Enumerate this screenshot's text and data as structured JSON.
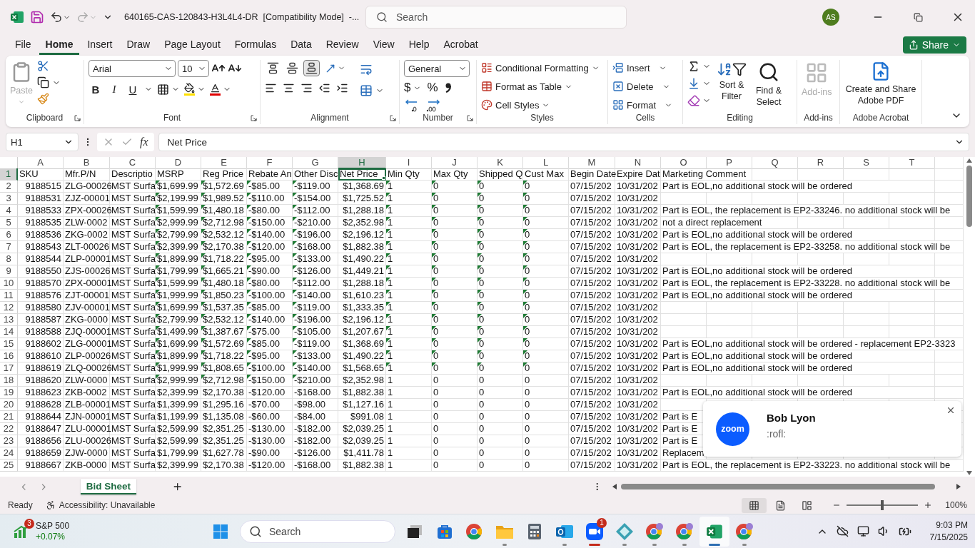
{
  "title_bar": {
    "document": "640165-CAS-120843-H3L4L4-DR  [Compatibility Mode]  -...",
    "search_placeholder": "Search",
    "avatar": "AS"
  },
  "menu_tabs": [
    {
      "label": "File",
      "selected": false
    },
    {
      "label": "Home",
      "selected": true
    },
    {
      "label": "Insert",
      "selected": false
    },
    {
      "label": "Draw",
      "selected": false
    },
    {
      "label": "Page Layout",
      "selected": false
    },
    {
      "label": "Formulas",
      "selected": false
    },
    {
      "label": "Data",
      "selected": false
    },
    {
      "label": "Review",
      "selected": false
    },
    {
      "label": "View",
      "selected": false
    },
    {
      "label": "Help",
      "selected": false
    },
    {
      "label": "Acrobat",
      "selected": false
    }
  ],
  "share_button": "Share",
  "ribbon": {
    "clipboard": {
      "paste": "Paste",
      "label": "Clipboard"
    },
    "font": {
      "font_name": "Arial",
      "font_size": "10",
      "bold": "B",
      "italic": "I",
      "underline": "U",
      "label": "Font"
    },
    "alignment": {
      "vertical": [
        {
          "kind": "top",
          "selected": false
        },
        {
          "kind": "middle",
          "selected": false
        },
        {
          "kind": "bottom",
          "selected": true
        }
      ],
      "label": "Alignment"
    },
    "number": {
      "format": "General",
      "currency": "$",
      "percent": "%",
      "label": "Number"
    },
    "styles": {
      "commands": [
        "Conditional Formatting",
        "Format as Table",
        "Cell Styles"
      ],
      "label": "Styles"
    },
    "cells": {
      "commands": [
        "Insert",
        "Delete",
        "Format"
      ],
      "label": "Cells"
    },
    "editing": {
      "sort": "Sort & Filter",
      "find": "Find & Select",
      "label": "Editing"
    },
    "addins": {
      "button": "Add-ins",
      "disabled": true,
      "label": "Add-ins"
    },
    "acrobat": {
      "button": "Create and Share Adobe PDF",
      "label": "Adobe Acrobat"
    }
  },
  "formula_bar": {
    "name_box": "H1",
    "function_symbol": "fx",
    "formula": "Net Price"
  },
  "sheet": {
    "columns": [
      {
        "letter": "A",
        "selected": false
      },
      {
        "letter": "B",
        "selected": false
      },
      {
        "letter": "C",
        "selected": false
      },
      {
        "letter": "D",
        "selected": false
      },
      {
        "letter": "E",
        "selected": false
      },
      {
        "letter": "F",
        "selected": false
      },
      {
        "letter": "G",
        "selected": false
      },
      {
        "letter": "H",
        "selected": true
      },
      {
        "letter": "I",
        "selected": false
      },
      {
        "letter": "J",
        "selected": false
      },
      {
        "letter": "K",
        "selected": false
      },
      {
        "letter": "L",
        "selected": false
      },
      {
        "letter": "M",
        "selected": false
      },
      {
        "letter": "N",
        "selected": false
      },
      {
        "letter": "O",
        "selected": false
      },
      {
        "letter": "P",
        "selected": false
      },
      {
        "letter": "Q",
        "selected": false
      },
      {
        "letter": "R",
        "selected": false
      },
      {
        "letter": "S",
        "selected": false
      },
      {
        "letter": "T",
        "selected": false
      }
    ],
    "rows": [
      {
        "number": "1",
        "selected": true,
        "flagged_prices": false,
        "flagged_qty": false,
        "cells": [
          "SKU",
          "Mfr.P/N",
          "Descriptio",
          "MSRP",
          "Reg Price",
          "Rebate An",
          "Other Disc",
          "Net Price",
          "Min Qty",
          "Max Qty",
          "Shipped Q",
          "Cust Max",
          "Begin Date",
          "Expire Dat"
        ],
        "comment": "Marketing Comment"
      },
      {
        "number": "2",
        "selected": false,
        "flagged_prices": true,
        "flagged_qty": true,
        "cells": [
          "9188515",
          "ZLG-00026",
          "MST Surfa",
          "$1,699.99",
          "$1,572.69",
          "-$85.00",
          "-$119.00",
          "$1,368.69",
          "1",
          "0",
          "0",
          "0",
          "07/15/202",
          "10/31/202"
        ],
        "comment": "Part is EOL,no additional stock will be ordered"
      },
      {
        "number": "3",
        "selected": false,
        "flagged_prices": true,
        "flagged_qty": true,
        "cells": [
          "9188531",
          "ZJZ-00001",
          "MST Surfa",
          "$2,199.99",
          "$1,989.52",
          "-$110.00",
          "-$154.00",
          "$1,725.52",
          "1",
          "0",
          "0",
          "0",
          "07/15/202",
          "10/31/202"
        ]
      },
      {
        "number": "4",
        "selected": false,
        "flagged_prices": true,
        "flagged_qty": true,
        "cells": [
          "9188533",
          "ZPX-00026",
          "MST Surfa",
          "$1,599.99",
          "$1,480.18",
          "-$80.00",
          "-$112.00",
          "$1,288.18",
          "1",
          "0",
          "0",
          "0",
          "07/15/202",
          "10/31/202"
        ],
        "comment": "Part is EOL, the replacement is EP2-33246. no additional stock will be"
      },
      {
        "number": "5",
        "selected": false,
        "flagged_prices": true,
        "flagged_qty": true,
        "cells": [
          "9188535",
          "ZLW-0002",
          "MST Surfa",
          "$2,999.99",
          "$2,712.98",
          "-$150.00",
          "-$210.00",
          "$2,352.98",
          "1",
          "0",
          "0",
          "0",
          "07/15/202",
          "10/31/202"
        ],
        "comment": "not a direct replacement"
      },
      {
        "number": "6",
        "selected": false,
        "flagged_prices": true,
        "flagged_qty": true,
        "cells": [
          "9188536",
          "ZKG-0002",
          "MST Surfa",
          "$2,799.99",
          "$2,532.12",
          "-$140.00",
          "-$196.00",
          "$2,196.12",
          "1",
          "0",
          "0",
          "0",
          "07/15/202",
          "10/31/202"
        ],
        "comment": "Part is EOL,no additional stock will be ordered"
      },
      {
        "number": "7",
        "selected": false,
        "flagged_prices": true,
        "flagged_qty": true,
        "cells": [
          "9188543",
          "ZLT-00026",
          "MST Surfa",
          "$2,399.99",
          "$2,170.38",
          "-$120.00",
          "-$168.00",
          "$1,882.38",
          "1",
          "0",
          "0",
          "0",
          "07/15/202",
          "10/31/202"
        ],
        "comment": "Part is EOL, the replacement is EP2-33258. no additional stock will be"
      },
      {
        "number": "8",
        "selected": false,
        "flagged_prices": true,
        "flagged_qty": true,
        "cells": [
          "9188544",
          "ZLP-00001",
          "MST Surfa",
          "$1,899.99",
          "$1,718.22",
          "-$95.00",
          "-$133.00",
          "$1,490.22",
          "1",
          "0",
          "0",
          "0",
          "07/15/202",
          "10/31/202"
        ]
      },
      {
        "number": "9",
        "selected": false,
        "flagged_prices": true,
        "flagged_qty": true,
        "cells": [
          "9188550",
          "ZJS-00026",
          "MST Surfa",
          "$1,799.99",
          "$1,665.21",
          "-$90.00",
          "-$126.00",
          "$1,449.21",
          "1",
          "0",
          "0",
          "0",
          "07/15/202",
          "10/31/202"
        ],
        "comment": "Part is EOL,no additional stock will be ordered"
      },
      {
        "number": "10",
        "selected": false,
        "flagged_prices": true,
        "flagged_qty": true,
        "cells": [
          "9188570",
          "ZPX-00001",
          "MST Surfa",
          "$1,599.99",
          "$1,480.18",
          "-$80.00",
          "-$112.00",
          "$1,288.18",
          "1",
          "0",
          "0",
          "0",
          "07/15/202",
          "10/31/202"
        ],
        "comment": "Part is EOL, the replacement is EP2-33228. no additional stock will be"
      },
      {
        "number": "11",
        "selected": false,
        "flagged_prices": true,
        "flagged_qty": true,
        "cells": [
          "9188576",
          "ZJT-00001",
          "MST Surfa",
          "$1,999.99",
          "$1,850.23",
          "-$100.00",
          "-$140.00",
          "$1,610.23",
          "1",
          "0",
          "0",
          "0",
          "07/15/202",
          "10/31/202"
        ],
        "comment": "Part is EOL,no additional stock will be ordered"
      },
      {
        "number": "12",
        "selected": false,
        "flagged_prices": true,
        "flagged_qty": true,
        "cells": [
          "9188580",
          "ZJV-00001",
          "MST Surfa",
          "$1,699.99",
          "$1,537.35",
          "-$85.00",
          "-$119.00",
          "$1,333.35",
          "1",
          "0",
          "0",
          "0",
          "07/15/202",
          "10/31/202"
        ]
      },
      {
        "number": "13",
        "selected": false,
        "flagged_prices": true,
        "flagged_qty": true,
        "cells": [
          "9188587",
          "ZKG-0000",
          "MST Surfa",
          "$2,799.99",
          "$2,532.12",
          "-$140.00",
          "-$196.00",
          "$2,196.12",
          "1",
          "0",
          "0",
          "0",
          "07/15/202",
          "10/31/202"
        ]
      },
      {
        "number": "14",
        "selected": false,
        "flagged_prices": true,
        "flagged_qty": true,
        "cells": [
          "9188588",
          "ZJQ-00001",
          "MST Surfa",
          "$1,499.99",
          "$1,387.67",
          "-$75.00",
          "-$105.00",
          "$1,207.67",
          "1",
          "0",
          "0",
          "0",
          "07/15/202",
          "10/31/202"
        ]
      },
      {
        "number": "15",
        "selected": false,
        "flagged_prices": true,
        "flagged_qty": true,
        "cells": [
          "9188602",
          "ZLG-00001",
          "MST Surfa",
          "$1,699.99",
          "$1,572.69",
          "-$85.00",
          "-$119.00",
          "$1,368.69",
          "1",
          "0",
          "0",
          "0",
          "07/15/202",
          "10/31/202"
        ],
        "comment": "Part is EOL,no additional stock will be ordered - replacement EP2-3323"
      },
      {
        "number": "16",
        "selected": false,
        "flagged_prices": true,
        "flagged_qty": true,
        "cells": [
          "9188610",
          "ZLP-00026",
          "MST Surfa",
          "$1,899.99",
          "$1,718.22",
          "-$95.00",
          "-$133.00",
          "$1,490.22",
          "1",
          "0",
          "0",
          "0",
          "07/15/202",
          "10/31/202"
        ],
        "comment": "Part is EOL,no additional stock will be ordered"
      },
      {
        "number": "17",
        "selected": false,
        "flagged_prices": true,
        "flagged_qty": true,
        "cells": [
          "9188619",
          "ZLQ-00026",
          "MST Surfa",
          "$1,999.99",
          "$1,808.65",
          "-$100.00",
          "-$140.00",
          "$1,568.65",
          "1",
          "0",
          "0",
          "0",
          "07/15/202",
          "10/31/202"
        ],
        "comment": "Part is EOL,no additional stock will be ordered"
      },
      {
        "number": "18",
        "selected": false,
        "flagged_prices": true,
        "flagged_qty": false,
        "cells": [
          "9188620",
          "ZLW-0000",
          "MST Surfa",
          "$2,999.99",
          "$2,712.98",
          "-$150.00",
          "-$210.00",
          "$2,352.98",
          "1",
          "0",
          "0",
          "0",
          "07/15/202",
          "10/31/202"
        ]
      },
      {
        "number": "19",
        "selected": false,
        "flagged_prices": false,
        "flagged_qty": false,
        "cells": [
          "9188623",
          "ZKB-0002",
          "MST Surfa",
          "$2,399.99",
          "$2,170.38",
          "-$120.00",
          "-$168.00",
          "$1,882.38",
          "1",
          "0",
          "0",
          "0",
          "07/15/202",
          "10/31/202"
        ],
        "comment": "Part is EOL,no additional stock will be ordered"
      },
      {
        "number": "20",
        "selected": false,
        "flagged_prices": false,
        "flagged_qty": false,
        "cells": [
          "9188628",
          "ZLB-00001",
          "MST Surfa",
          "$1,399.99",
          "$1,295.16",
          "-$70.00",
          "-$98.00",
          "$1,127.16",
          "1",
          "0",
          "0",
          "0",
          "07/15/202",
          "10/31/202"
        ]
      },
      {
        "number": "21",
        "selected": false,
        "flagged_prices": false,
        "flagged_qty": false,
        "cells": [
          "9188644",
          "ZJN-00001",
          "MST Surfa",
          "$1,199.99",
          "$1,135.08",
          "-$60.00",
          "-$84.00",
          "$991.08",
          "1",
          "0",
          "0",
          "0",
          "07/15/202",
          "10/31/202"
        ],
        "comment": "Part is E"
      },
      {
        "number": "22",
        "selected": false,
        "flagged_prices": false,
        "flagged_qty": false,
        "cells": [
          "9188647",
          "ZLU-00001",
          "MST Surfa",
          "$2,599.99",
          "$2,351.25",
          "-$130.00",
          "-$182.00",
          "$2,039.25",
          "1",
          "0",
          "0",
          "0",
          "07/15/202",
          "10/31/202"
        ],
        "comment": "Part is E"
      },
      {
        "number": "23",
        "selected": false,
        "flagged_prices": false,
        "flagged_qty": false,
        "cells": [
          "9188656",
          "ZLU-00026",
          "MST Surfa",
          "$2,599.99",
          "$2,351.25",
          "-$130.00",
          "-$182.00",
          "$2,039.25",
          "1",
          "0",
          "0",
          "0",
          "07/15/202",
          "10/31/202"
        ],
        "comment": "Part is E"
      },
      {
        "number": "24",
        "selected": false,
        "flagged_prices": false,
        "flagged_qty": false,
        "cells": [
          "9188659",
          "ZJW-0000",
          "MST Surfa",
          "$1,799.99",
          "$1,627.78",
          "-$90.00",
          "-$126.00",
          "$1,411.78",
          "1",
          "0",
          "0",
          "0",
          "07/15/202",
          "10/31/202"
        ],
        "comment": "Replacem"
      },
      {
        "number": "25",
        "selected": false,
        "flagged_prices": false,
        "flagged_qty": false,
        "cells": [
          "9188667",
          "ZKB-0000",
          "MST Surfa",
          "$2,399.99",
          "$2,170.38",
          "-$120.00",
          "-$168.00",
          "$1,882.38",
          "1",
          "0",
          "0",
          "0",
          "07/15/202",
          "10/31/202"
        ],
        "comment": "Part is EOL, the replacement is EP2-33223. no additional stock will be"
      }
    ]
  },
  "sheet_tabs": [
    {
      "label": "Bid Sheet",
      "selected": true
    }
  ],
  "status_bar": {
    "state": "Ready",
    "accessibility": "Accessibility: Unavailable",
    "views": [
      {
        "kind": "normal",
        "selected": true
      },
      {
        "kind": "page_layout",
        "selected": false
      },
      {
        "kind": "page_break",
        "selected": false
      }
    ],
    "zoom_slider": {
      "level": 0.5
    },
    "zoom": "100%"
  },
  "notification": {
    "logo": "zoom",
    "sender": "Bob Lyon",
    "message": ":rofl:"
  },
  "taskbar": {
    "widget": {
      "badge": "3",
      "title": "S&P 500",
      "change": "+0.07%"
    },
    "search_placeholder": "Search",
    "apps": [
      {
        "kind": "task_view",
        "running": false,
        "selected": false,
        "attention": false
      },
      {
        "kind": "store",
        "running": false,
        "selected": false,
        "attention": false
      },
      {
        "kind": "chrome",
        "running": false,
        "selected": false,
        "attention": false
      },
      {
        "kind": "files",
        "running": true,
        "selected": false,
        "attention": false
      },
      {
        "kind": "calculator",
        "running": false,
        "selected": false,
        "attention": false
      },
      {
        "kind": "outlook",
        "running": true,
        "selected": false,
        "attention": false
      },
      {
        "kind": "zoom",
        "running": true,
        "selected": false,
        "attention": true,
        "badge": "1"
      },
      {
        "kind": "diamond",
        "running": true,
        "selected": false,
        "attention": false
      },
      {
        "kind": "chrome_profile",
        "running": true,
        "selected": false,
        "attention": false
      },
      {
        "kind": "chrome_profile",
        "running": true,
        "selected": false,
        "attention": false
      },
      {
        "kind": "excel",
        "running": true,
        "selected": true,
        "attention": false
      },
      {
        "kind": "chrome_profile",
        "running": true,
        "selected": false,
        "attention": false
      }
    ],
    "clock": {
      "time": "9:03 PM",
      "date": "7/15/2025"
    }
  }
}
